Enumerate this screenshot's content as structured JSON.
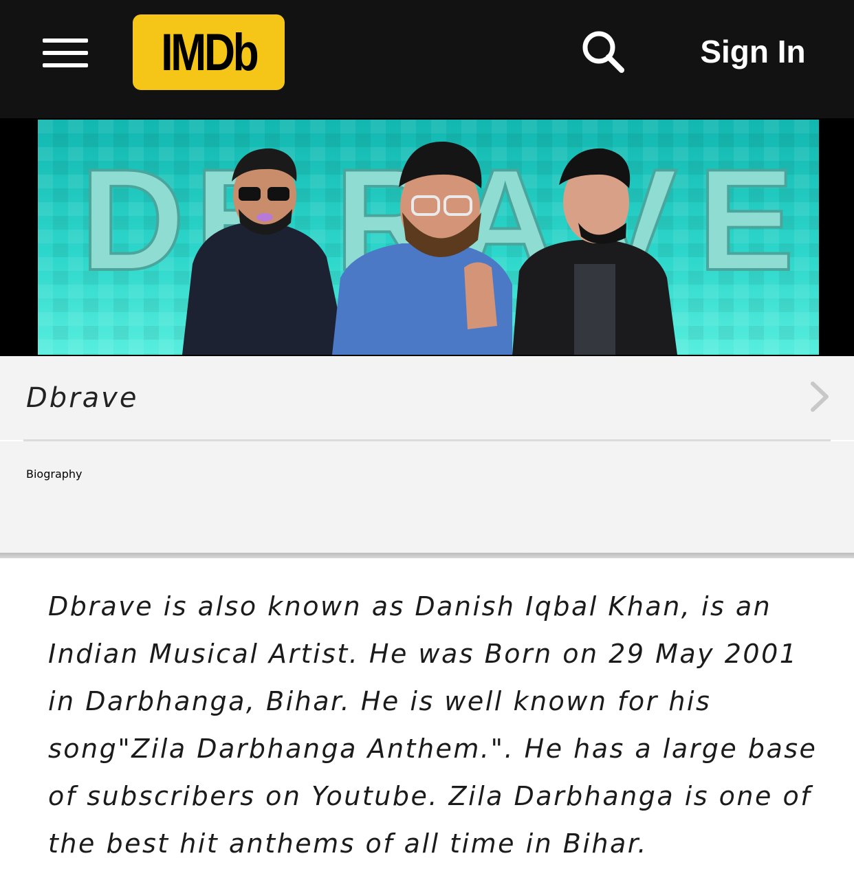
{
  "header": {
    "logo_text": "IMDb",
    "sign_in_label": "Sign In",
    "brand_color": "#f5c518",
    "bar_color": "#121212",
    "icons": {
      "menu": "hamburger-menu-icon",
      "search": "search-icon"
    }
  },
  "banner": {
    "headline_letters": "DBRAVE",
    "background_color": "#2fd8cc"
  },
  "name_row": {
    "name": "Dbrave",
    "icon": "chevron-right-icon"
  },
  "section": {
    "title": "Biography"
  },
  "biography": {
    "text": "Dbrave is also known as Danish Iqbal Khan, is an Indian Musical Artist. He was Born on 29 May 2001 in Darbhanga, Bihar. He is well known for his song\"Zila Darbhanga Anthem.\". He has a large base of subscribers on Youtube. Zila Darbhanga is one of the best hit anthems of all time in Bihar."
  }
}
